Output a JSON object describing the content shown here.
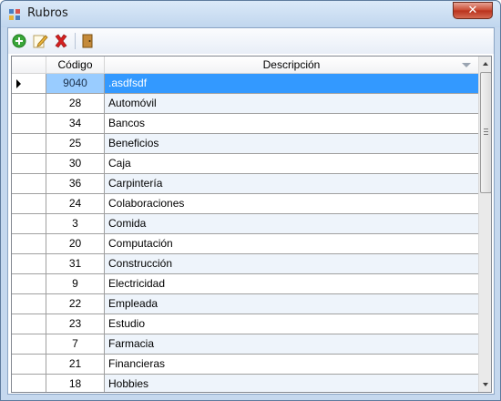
{
  "window": {
    "title": "Rubros",
    "close_label": "✕"
  },
  "toolbar": {
    "buttons": [
      {
        "name": "add-icon",
        "color": "#3aa63a"
      },
      {
        "name": "edit-icon",
        "color": "#e8b33a"
      },
      {
        "name": "delete-icon",
        "color": "#d42020"
      },
      {
        "name": "exit-icon",
        "color": "#c48a3a"
      }
    ]
  },
  "grid": {
    "columns": [
      "Código",
      "Descripción"
    ],
    "selected_index": 0,
    "rows": [
      {
        "code": "9040",
        "desc": ".asdfsdf"
      },
      {
        "code": "28",
        "desc": "Automóvil"
      },
      {
        "code": "34",
        "desc": "Bancos"
      },
      {
        "code": "25",
        "desc": "Beneficios"
      },
      {
        "code": "30",
        "desc": "Caja"
      },
      {
        "code": "36",
        "desc": "Carpintería"
      },
      {
        "code": "24",
        "desc": "Colaboraciones"
      },
      {
        "code": "3",
        "desc": "Comida"
      },
      {
        "code": "20",
        "desc": "Computación"
      },
      {
        "code": "31",
        "desc": "Construcción"
      },
      {
        "code": "9",
        "desc": "Electricidad"
      },
      {
        "code": "22",
        "desc": "Empleada"
      },
      {
        "code": "23",
        "desc": "Estudio"
      },
      {
        "code": "7",
        "desc": "Farmacia"
      },
      {
        "code": "21",
        "desc": "Financieras"
      },
      {
        "code": "18",
        "desc": "Hobbies"
      }
    ]
  }
}
